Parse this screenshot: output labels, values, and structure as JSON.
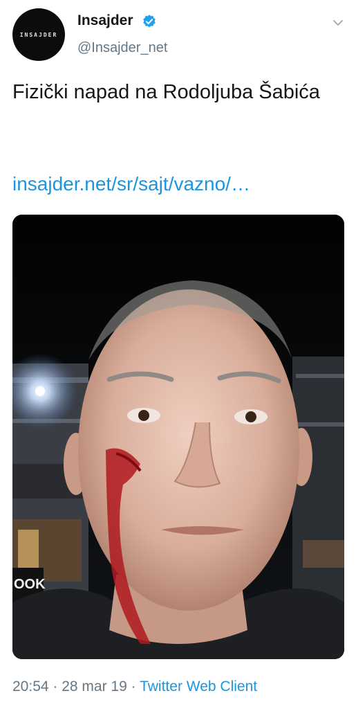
{
  "account": {
    "display_name": "Insajder",
    "handle": "@Insajder_net",
    "avatar_text": "INSAJDER",
    "verified": true
  },
  "tweet": {
    "text": "Fizički napad na Rodoljuba Šabića",
    "link": "insajder.net/sr/sajt/vazno/…",
    "time": "20:54",
    "date": "28 mar 19",
    "client": "Twitter Web Client",
    "separator": " · "
  },
  "icons": {
    "verified": "verified-badge-icon",
    "menu": "chevron-down-icon"
  },
  "photo": {
    "sign_text": "OOK"
  },
  "colors": {
    "link": "#1b95e0",
    "secondary_text": "#657786",
    "primary_text": "#14171a",
    "verified": "#1da1f2"
  }
}
